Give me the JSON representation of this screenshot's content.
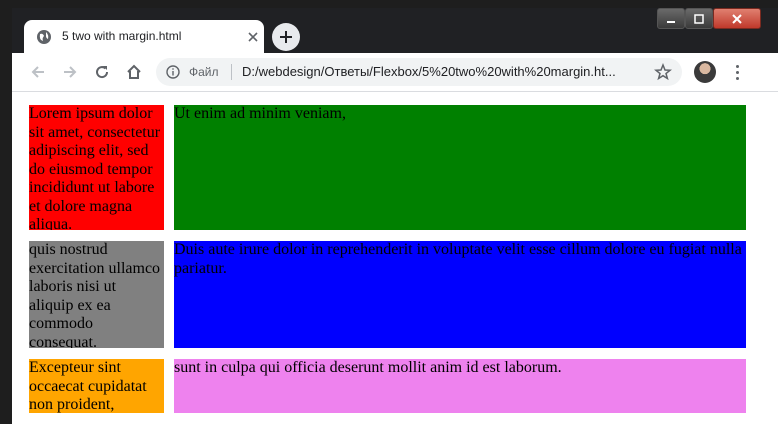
{
  "browser": {
    "tab_title": "5 two with margin.html",
    "site_label": "Файл",
    "url": "D:/webdesign/Ответы/Flexbox/5%20two%20with%20margin.ht...",
    "icons": [
      "globe-icon",
      "close-icon",
      "plus-icon",
      "back-icon",
      "forward-icon",
      "reload-icon",
      "home-icon",
      "info-icon",
      "star-icon",
      "menu-icon"
    ]
  },
  "page": {
    "rows": [
      {
        "left": {
          "text": "Lorem ipsum dolor sit amet, consectetur adipiscing elit, sed do eiusmod tempor incididunt ut labore et dolore magna aliqua.",
          "color": "#ff0000"
        },
        "right": {
          "text": "Ut enim ad minim veniam,",
          "color": "#008000"
        }
      },
      {
        "left": {
          "text": "quis nostrud exercitation ullamco laboris nisi ut aliquip ex ea commodo consequat.",
          "color": "#808080"
        },
        "right": {
          "text": "Duis aute irure dolor in reprehenderit in voluptate velit esse cillum dolore eu fugiat nulla pariatur.",
          "color": "#0000ff"
        }
      },
      {
        "left": {
          "text": "Excepteur sint occaecat cupidatat non proident,",
          "color": "#ffa500"
        },
        "right": {
          "text": "sunt in culpa qui officia deserunt mollit anim id est laborum.",
          "color": "#ee82ee"
        }
      }
    ]
  }
}
